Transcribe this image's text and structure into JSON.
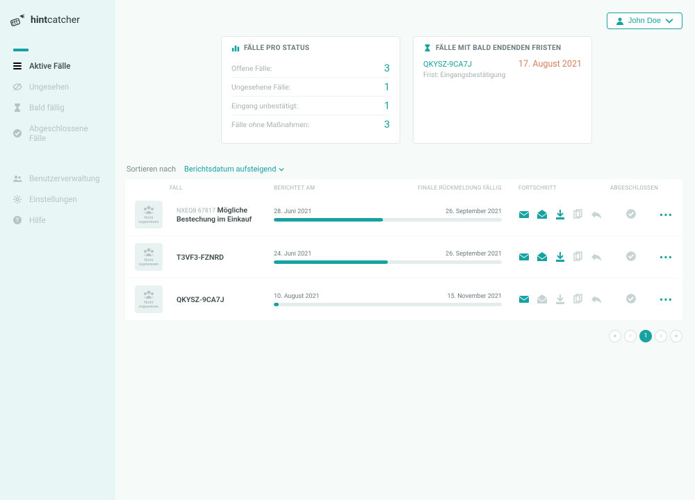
{
  "brand": {
    "bold": "hint",
    "normal": "catcher"
  },
  "user": {
    "name": "John Doe"
  },
  "sidebar": {
    "items": [
      {
        "label": "Aktive Fälle",
        "icon": "list-icon",
        "active": true
      },
      {
        "label": "Ungesehen",
        "icon": "eye-off-icon",
        "active": false
      },
      {
        "label": "Bald fällig",
        "icon": "hourglass-icon",
        "active": false
      },
      {
        "label": "Abgeschlossene Fälle",
        "icon": "check-circle-icon",
        "active": false
      }
    ],
    "items2": [
      {
        "label": "Benutzerverwaltung",
        "icon": "users-icon"
      },
      {
        "label": "Einstellungen",
        "icon": "gear-icon"
      },
      {
        "label": "Hilfe",
        "icon": "help-icon"
      }
    ]
  },
  "statusCard": {
    "title": "FÄLLE PRO STATUS",
    "rows": [
      {
        "label": "Offene Fälle:",
        "value": "3"
      },
      {
        "label": "Ungesehene Fälle:",
        "value": "1"
      },
      {
        "label": "Eingang unbestätigt:",
        "value": "1"
      },
      {
        "label": "Fälle ohne Maßnahmen:",
        "value": "3"
      }
    ]
  },
  "deadlineCard": {
    "title": "FÄLLE MIT BALD ENDENDEN FRISTEN",
    "caseCode": "QKYSZ-9CA7J",
    "date": "17. August 2021",
    "sub": "Frist: Eingangsbestätigung"
  },
  "sort": {
    "label": "Sortieren nach",
    "value": "Berichtsdatum aufsteigend"
  },
  "tableHead": {
    "case": "FALL",
    "reported": "BERICHTET AM",
    "due": "FINALE RÜCKMELDUNG FÄLLIG",
    "actions": "FORTSCHRITT",
    "done": "ABGESCHLOSSEN"
  },
  "assignLabel": "Nicht zugewiesen",
  "rows": [
    {
      "code": "NXEQ8 67817",
      "title": "Mögliche Bestechung im Einkauf",
      "reported": "28. Juni 2021",
      "due": "26. September 2021",
      "progressPct": 48,
      "actions": {
        "mail": true,
        "open": true,
        "download": true,
        "files": false,
        "reply": false
      }
    },
    {
      "code": "T3VF3-FZNRD",
      "title": "",
      "reported": "24. Juni 2021",
      "due": "26. September 2021",
      "progressPct": 50,
      "actions": {
        "mail": true,
        "open": true,
        "download": true,
        "files": false,
        "reply": false
      }
    },
    {
      "code": "QKYSZ-9CA7J",
      "title": "",
      "reported": "10. August 2021",
      "due": "15. November 2021",
      "progressPct": 2,
      "actions": {
        "mail": true,
        "open": false,
        "download": false,
        "files": false,
        "reply": false
      }
    }
  ],
  "pagination": {
    "current": "1"
  }
}
